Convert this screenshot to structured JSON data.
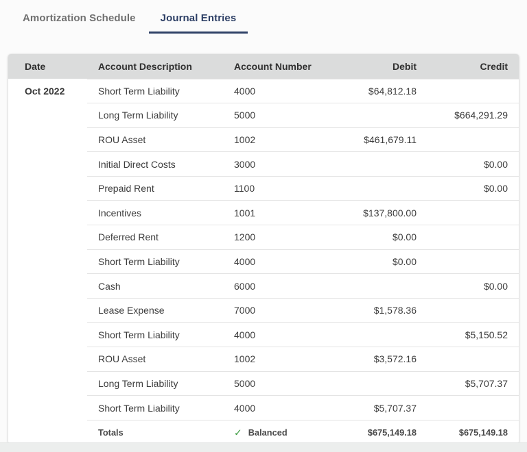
{
  "colors": {
    "accent_navy": "#2e4066",
    "inactive_tab": "#707070",
    "header_bg": "#dbdcdc",
    "separator": "#e4e4e4",
    "balanced_check_green": "#43a047"
  },
  "tabs": [
    {
      "label": "Amortization Schedule",
      "active": false
    },
    {
      "label": "Journal Entries",
      "active": true
    }
  ],
  "table": {
    "columns": [
      "Date",
      "Account Description",
      "Account Number",
      "Debit",
      "Credit"
    ],
    "rows": [
      {
        "date": "Oct 2022",
        "description": "Short Term Liability",
        "account": "4000",
        "debit": "$64,812.18",
        "credit": ""
      },
      {
        "date": "",
        "description": "Long Term Liability",
        "account": "5000",
        "debit": "",
        "credit": "$664,291.29"
      },
      {
        "date": "",
        "description": "ROU Asset",
        "account": "1002",
        "debit": "$461,679.11",
        "credit": ""
      },
      {
        "date": "",
        "description": "Initial Direct Costs",
        "account": "3000",
        "debit": "",
        "credit": "$0.00"
      },
      {
        "date": "",
        "description": "Prepaid Rent",
        "account": "1100",
        "debit": "",
        "credit": "$0.00"
      },
      {
        "date": "",
        "description": "Incentives",
        "account": "1001",
        "debit": "$137,800.00",
        "credit": ""
      },
      {
        "date": "",
        "description": "Deferred Rent",
        "account": "1200",
        "debit": "$0.00",
        "credit": ""
      },
      {
        "date": "",
        "description": "Short Term Liability",
        "account": "4000",
        "debit": "$0.00",
        "credit": ""
      },
      {
        "date": "",
        "description": "Cash",
        "account": "6000",
        "debit": "",
        "credit": "$0.00"
      },
      {
        "date": "",
        "description": "Lease Expense",
        "account": "7000",
        "debit": "$1,578.36",
        "credit": ""
      },
      {
        "date": "",
        "description": "Short Term Liability",
        "account": "4000",
        "debit": "",
        "credit": "$5,150.52"
      },
      {
        "date": "",
        "description": "ROU Asset",
        "account": "1002",
        "debit": "$3,572.16",
        "credit": ""
      },
      {
        "date": "",
        "description": "Long Term Liability",
        "account": "5000",
        "debit": "",
        "credit": "$5,707.37"
      },
      {
        "date": "",
        "description": "Short Term Liability",
        "account": "4000",
        "debit": "$5,707.37",
        "credit": ""
      }
    ],
    "totals": {
      "label": "Totals",
      "status_icon": "check-icon",
      "status_check_glyph": "✓",
      "status": "Balanced",
      "debit": "$675,149.18",
      "credit": "$675,149.18"
    }
  }
}
